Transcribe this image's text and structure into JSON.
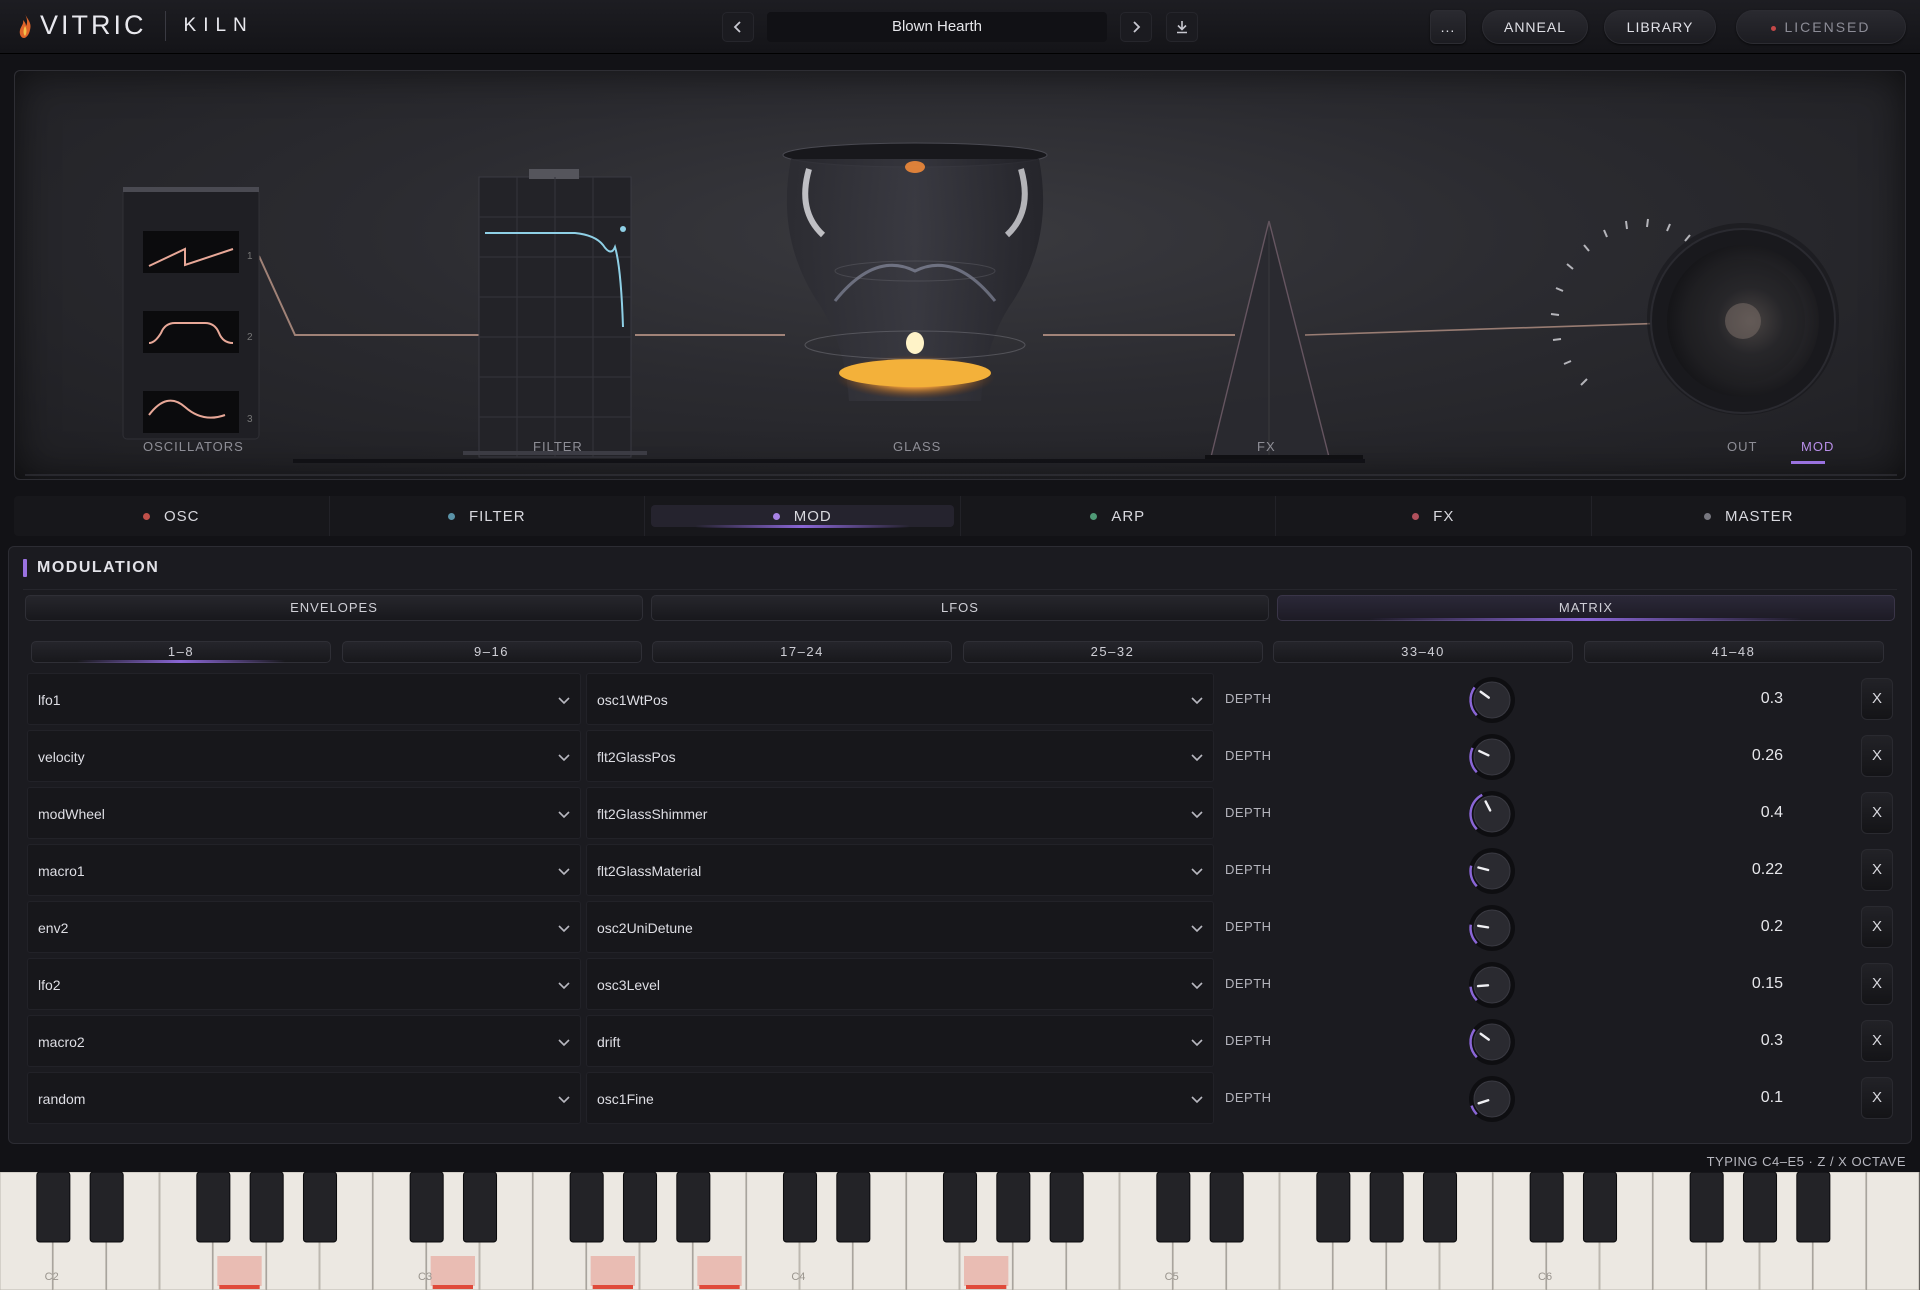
{
  "header": {
    "logo": "VITRIC",
    "product": "KILN",
    "preset_name": "Blown Hearth",
    "more_label": "...",
    "anneal_label": "ANNEAL",
    "library_label": "LIBRARY",
    "license_label": "LICENSED"
  },
  "visual": {
    "oscillators_label": "OSCILLATORS",
    "osc_numbers": [
      "1",
      "2",
      "3"
    ],
    "filter_label": "FILTER",
    "glass_label": "GLASS",
    "fx_label": "FX",
    "out_label": "OUT",
    "mod_label": "MOD"
  },
  "section_tabs": [
    {
      "label": "OSC",
      "led": "#c0504a",
      "active": false
    },
    {
      "label": "FILTER",
      "led": "#5a93a8",
      "active": false
    },
    {
      "label": "MOD",
      "led": "#a883e6",
      "active": true
    },
    {
      "label": "ARP",
      "led": "#4f9a76",
      "active": false
    },
    {
      "label": "FX",
      "led": "#b0505c",
      "active": false
    },
    {
      "label": "MASTER",
      "led": "#77777f",
      "active": false
    }
  ],
  "modulation": {
    "title": "MODULATION",
    "tabs": [
      "ENVELOPES",
      "LFOS",
      "MATRIX"
    ],
    "active_tab": "MATRIX",
    "pages": [
      "1–8",
      "9–16",
      "17–24",
      "25–32",
      "33–40",
      "41–48"
    ],
    "active_page": "1–8",
    "depth_label": "DEPTH",
    "remove_label": "X",
    "rows": [
      {
        "source": "lfo1",
        "target": "osc1WtPos",
        "depth": "0.3"
      },
      {
        "source": "velocity",
        "target": "flt2GlassPos",
        "depth": "0.26"
      },
      {
        "source": "modWheel",
        "target": "flt2GlassShimmer",
        "depth": "0.4"
      },
      {
        "source": "macro1",
        "target": "flt2GlassMaterial",
        "depth": "0.22"
      },
      {
        "source": "env2",
        "target": "osc2UniDetune",
        "depth": "0.2"
      },
      {
        "source": "lfo2",
        "target": "osc3Level",
        "depth": "0.15"
      },
      {
        "source": "macro2",
        "target": "drift",
        "depth": "0.3"
      },
      {
        "source": "random",
        "target": "osc1Fine",
        "depth": "0.1"
      }
    ]
  },
  "keyboard": {
    "hint": "TYPING C4–E5 · Z / X OCTAVE",
    "octave_labels": [
      "C2",
      "C3",
      "C4",
      "C5",
      "C6"
    ],
    "highlighted_keys": [
      4,
      8,
      11,
      13,
      18
    ]
  },
  "colors": {
    "accent": "#9a72e0",
    "flame": "#f2a03a",
    "license_dot": "#c44848"
  }
}
